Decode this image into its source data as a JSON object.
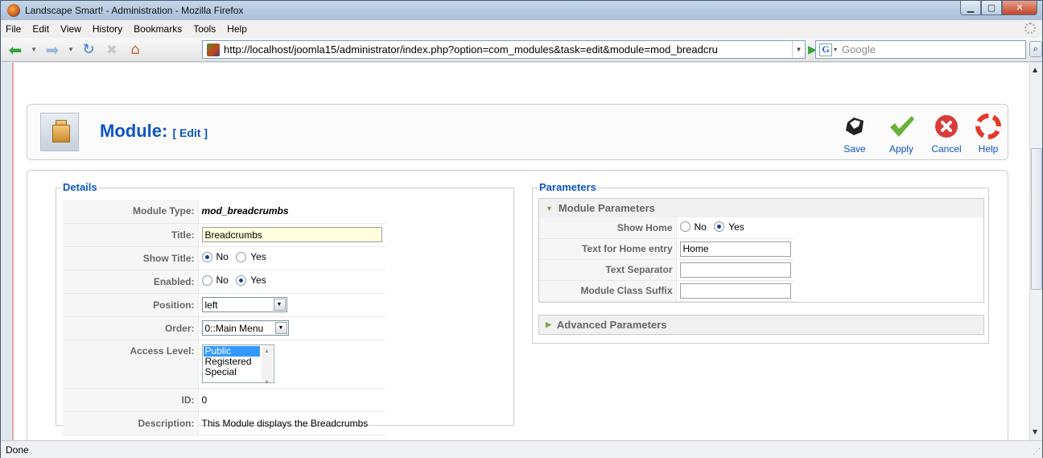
{
  "window": {
    "title": "Landscape Smart! - Administration - Mozilla Firefox"
  },
  "menu": [
    "File",
    "Edit",
    "View",
    "History",
    "Bookmarks",
    "Tools",
    "Help"
  ],
  "nav": {
    "url": "http://localhost/joomla15/administrator/index.php?option=com_modules&task=edit&module=mod_breadcru",
    "search_placeholder": "Google"
  },
  "header": {
    "title": "Module:",
    "subtitle": "[ Edit ]"
  },
  "toolbar": {
    "save": "Save",
    "apply": "Apply",
    "cancel": "Cancel",
    "help": "Help"
  },
  "details": {
    "legend": "Details",
    "labels": {
      "module_type": "Module Type:",
      "title": "Title:",
      "show_title": "Show Title:",
      "enabled": "Enabled:",
      "position": "Position:",
      "order": "Order:",
      "access": "Access Level:",
      "id": "ID:",
      "description": "Description:"
    },
    "module_type": "mod_breadcrumbs",
    "title_value": "Breadcrumbs",
    "show_title": {
      "no": "No",
      "yes": "Yes",
      "selected": "No"
    },
    "enabled": {
      "no": "No",
      "yes": "Yes",
      "selected": "Yes"
    },
    "position": "left",
    "order": "0::Main Menu",
    "access_options": [
      "Public",
      "Registered",
      "Special"
    ],
    "access_selected": "Public",
    "id": "0",
    "description": "This Module displays the Breadcrumbs"
  },
  "params": {
    "legend": "Parameters",
    "module_params_head": "Module Parameters",
    "advanced_params_head": "Advanced Parameters",
    "labels": {
      "show_home": "Show Home",
      "home_text": "Text for Home entry",
      "separator": "Text Separator",
      "class_suffix": "Module Class Suffix"
    },
    "show_home": {
      "no": "No",
      "yes": "Yes",
      "selected": "Yes"
    },
    "home_text": "Home",
    "separator": "",
    "class_suffix": ""
  },
  "status": "Done"
}
